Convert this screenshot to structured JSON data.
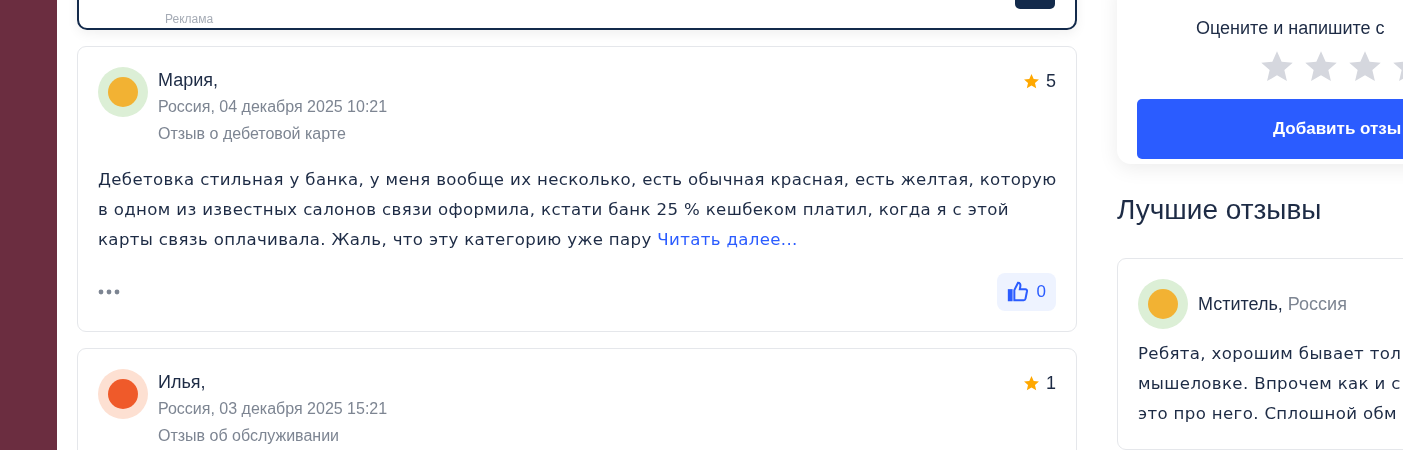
{
  "ad": {
    "label": "Реклама"
  },
  "reviews": [
    {
      "author": "Мария,",
      "kind": "happy",
      "meta": "Россия, 04 декабря 2025 10:21",
      "topic": "Отзыв о дебетовой карте",
      "rating": "5",
      "text": "Дебетовка стильная у банка, у меня вообще их несколько, есть обычная красная, есть желтая, которую в одном из известных салонов связи оформила, кстати банк 25 % кешбеком платил, когда я с этой карты связь оплачивала. Жаль, что эту категорию уже пару",
      "read_more": "Читать далее...",
      "likes": "0"
    },
    {
      "author": "Илья,",
      "kind": "angry",
      "meta": "Россия, 03 декабря 2025 15:21",
      "topic": "Отзыв об обслуживании",
      "rating": "1"
    }
  ],
  "rate_card": {
    "prompt": "Оцените и напишите с",
    "stars": 0,
    "button": "Добавить отзы"
  },
  "best": {
    "title": "Лучшие отзывы",
    "author": "Мститель,",
    "country": "Россия",
    "kind": "happy",
    "text": [
      "Ребята, хорошим бывает тол",
      "мышеловке. Впрочем как и с",
      "это про него. Сплошной обм"
    ]
  }
}
